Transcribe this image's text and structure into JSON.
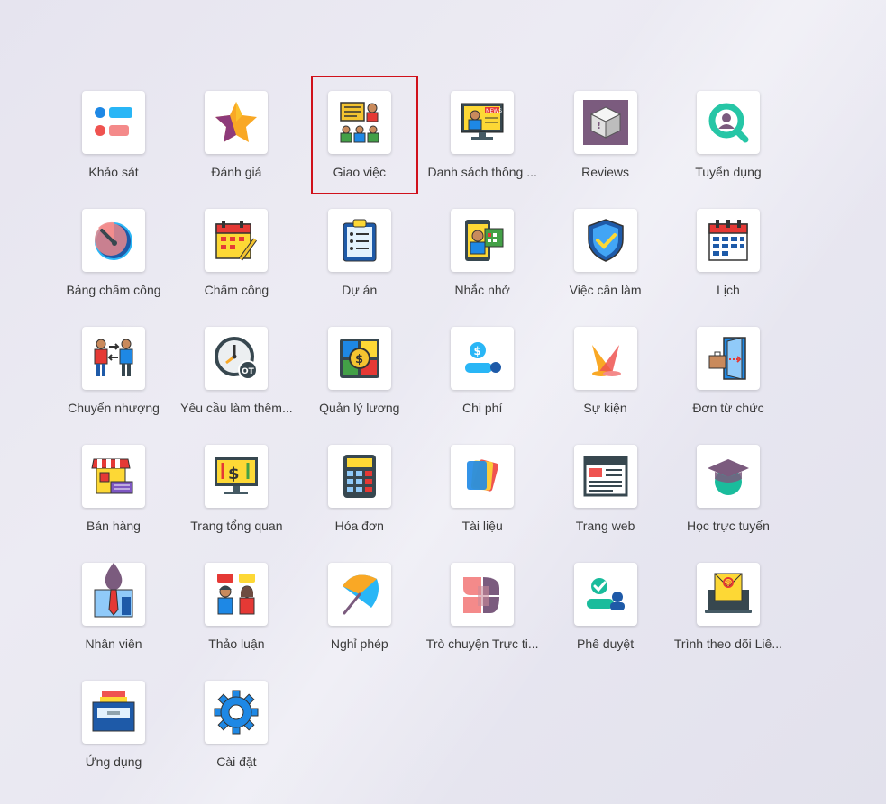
{
  "apps": [
    {
      "label": "Khảo sát",
      "icon": "survey-icon"
    },
    {
      "label": "Đánh giá",
      "icon": "star-icon"
    },
    {
      "label": "Giao việc",
      "icon": "team-assignment-icon"
    },
    {
      "label": "Danh sách thông ...",
      "icon": "news-icon"
    },
    {
      "label": "Reviews",
      "icon": "box-review-icon"
    },
    {
      "label": "Tuyển dụng",
      "icon": "recruitment-search-icon"
    },
    {
      "label": "Bảng chấm công",
      "icon": "gauge-icon"
    },
    {
      "label": "Chấm công",
      "icon": "calendar-pen-icon"
    },
    {
      "label": "Dự án",
      "icon": "clipboard-icon"
    },
    {
      "label": "Nhắc nhở",
      "icon": "reminder-phone-icon"
    },
    {
      "label": "Việc cần làm",
      "icon": "shield-check-icon"
    },
    {
      "label": "Lịch",
      "icon": "calendar-icon"
    },
    {
      "label": "Chuyển nhượng",
      "icon": "transfer-people-icon"
    },
    {
      "label": "Yêu cầu làm thêm...",
      "icon": "overtime-clock-icon"
    },
    {
      "label": "Quản lý lương",
      "icon": "payroll-icon"
    },
    {
      "label": "Chi phí",
      "icon": "expense-icon"
    },
    {
      "label": "Sự kiện",
      "icon": "event-spotlight-icon"
    },
    {
      "label": "Đơn từ chức",
      "icon": "resignation-door-icon"
    },
    {
      "label": "Bán hàng",
      "icon": "shop-cart-icon"
    },
    {
      "label": "Trang tổng quan",
      "icon": "dashboard-monitor-icon"
    },
    {
      "label": "Hóa đơn",
      "icon": "calculator-icon"
    },
    {
      "label": "Tài liệu",
      "icon": "documents-icon"
    },
    {
      "label": "Trang web",
      "icon": "website-icon"
    },
    {
      "label": "Học trực tuyến",
      "icon": "graduation-cap-icon"
    },
    {
      "label": "Nhân viên",
      "icon": "employee-tie-icon"
    },
    {
      "label": "Thảo luận",
      "icon": "discussion-icon"
    },
    {
      "label": "Nghỉ phép",
      "icon": "umbrella-icon"
    },
    {
      "label": "Trò chuyện Trực ti...",
      "icon": "live-chat-icon"
    },
    {
      "label": "Phê duyệt",
      "icon": "approval-icon"
    },
    {
      "label": "Trình theo dõi Liê...",
      "icon": "email-laptop-icon"
    },
    {
      "label": "Ứng dụng",
      "icon": "app-drawer-icon"
    },
    {
      "label": "Cài đặt",
      "icon": "gear-icon"
    }
  ],
  "colors": {
    "highlight": "#d0111b",
    "tile": "#ffffff",
    "label": "#3a3a3a"
  }
}
